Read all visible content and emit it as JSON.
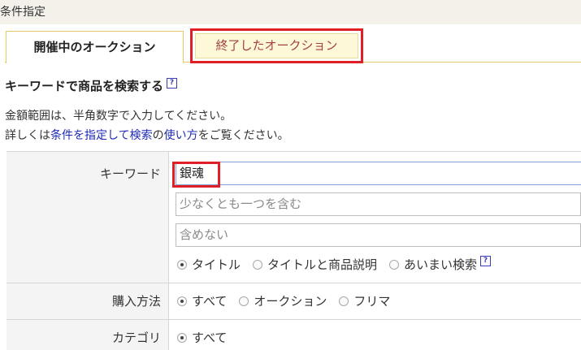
{
  "header": {
    "title": "条件指定"
  },
  "tabs": {
    "active": "開催中のオークション",
    "inactive": "終了したオークション"
  },
  "section": {
    "title": "キーワードで商品を検索する",
    "help_glyph": "?",
    "note_line1": "金額範囲は、半角数字で入力してください。",
    "note_line2_prefix": "詳しくは",
    "note_link1": "条件を指定して検索",
    "note_link_mid": "の",
    "note_link2": "使い方",
    "note_line2_suffix": "をご覧ください。"
  },
  "keyword": {
    "label": "キーワード",
    "value": "銀魂",
    "any_placeholder": "少なくとも一つを含む",
    "exclude_placeholder": "含めない",
    "scope_options": [
      "タイトル",
      "タイトルと商品説明",
      "あいまい検索"
    ],
    "scope_selected": "タイトル"
  },
  "purchase": {
    "label": "購入方法",
    "options": [
      "すべて",
      "オークション",
      "フリマ"
    ],
    "selected": "すべて"
  },
  "category": {
    "label": "カテゴリ",
    "options": [
      "すべて"
    ],
    "selected": "すべて"
  },
  "colors": {
    "highlight_box": "#e01e25",
    "tab_border": "#e6c96a",
    "inactive_tab_bg": "#fdf8d8",
    "link": "#1e2bb5"
  }
}
